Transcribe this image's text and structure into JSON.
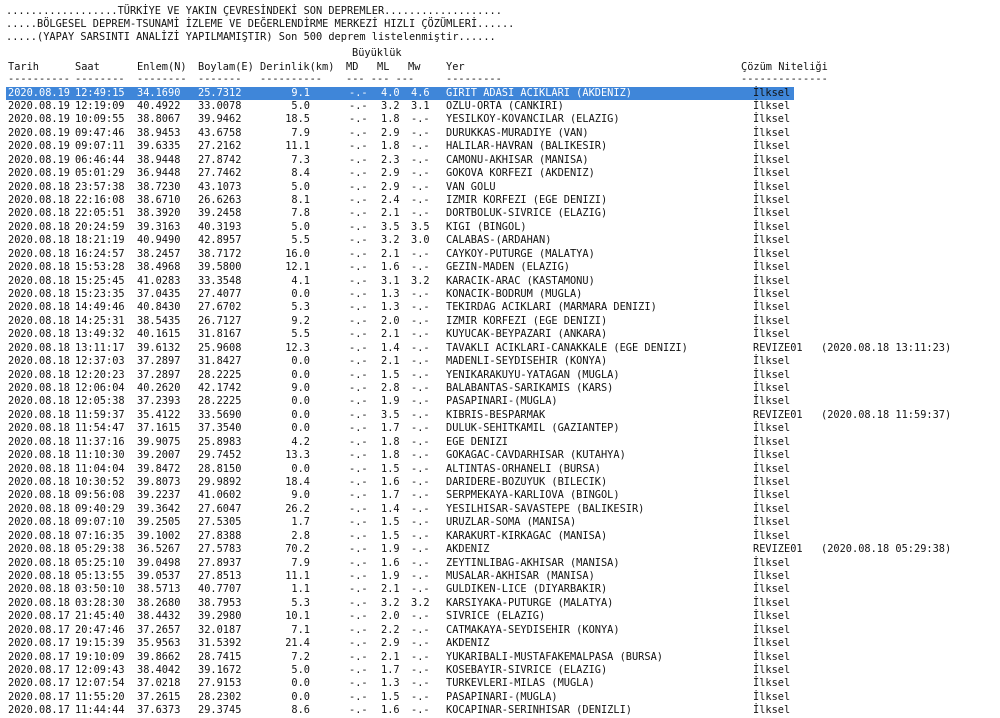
{
  "header": {
    "line1": "..................TÜRKİYE VE YAKIN ÇEVRESİNDEKİ SON DEPREMLER...................",
    "line2": ".....BÖLGESEL DEPREM-TSUNAMİ İZLEME VE DEĞERLENDİRME MERKEZİ HIZLI ÇÖZÜMLERİ......",
    "line3": ".....(YAPAY SARSINTI ANALİZİ YAPILMAMIŞTIR) Son 500 deprem listelenmiştir......"
  },
  "columns": {
    "buyukluk": "Büyüklük",
    "tarih": "Tarih",
    "saat": "Saat",
    "enlem": "Enlem(N)",
    "boylam": "Boylam(E)",
    "derinlik": "Derinlik(km)",
    "md": "MD",
    "ml": "ML",
    "mw": "Mw",
    "yer": "Yer",
    "cozum": "Çözüm Niteliği"
  },
  "dash_lines": {
    "tarih": "----------",
    "saat": "--------",
    "enlem": "--------",
    "boylam": "-------",
    "derinlik": "----------",
    "mag": "--- --- ---",
    "yer": "---------",
    "cozum": "--------------"
  },
  "rows": [
    {
      "date": "2020.08.19",
      "time": "12:49:15",
      "lat": "34.1690",
      "lon": "25.7312",
      "depth": "9.1",
      "md": "-.-",
      "ml": "4.0",
      "mw": "4.6",
      "place": "GIRIT ADASI ACIKLARI (AKDENIZ)",
      "quality": "İlksel",
      "selected": true
    },
    {
      "date": "2020.08.19",
      "time": "12:19:09",
      "lat": "40.4922",
      "lon": "33.0078",
      "depth": "5.0",
      "md": "-.-",
      "ml": "3.2",
      "mw": "3.1",
      "place": "OZLU-ORTA (CANKIRI)",
      "quality": "İlksel"
    },
    {
      "date": "2020.08.19",
      "time": "10:09:55",
      "lat": "38.8067",
      "lon": "39.9462",
      "depth": "18.5",
      "md": "-.-",
      "ml": "1.8",
      "mw": "-.-",
      "place": "YESILKOY-KOVANCILAR (ELAZIG)",
      "quality": "İlksel"
    },
    {
      "date": "2020.08.19",
      "time": "09:47:46",
      "lat": "38.9453",
      "lon": "43.6758",
      "depth": "7.9",
      "md": "-.-",
      "ml": "2.9",
      "mw": "-.-",
      "place": "DURUKKAS-MURADIYE (VAN)",
      "quality": "İlksel"
    },
    {
      "date": "2020.08.19",
      "time": "09:07:11",
      "lat": "39.6335",
      "lon": "27.2162",
      "depth": "11.1",
      "md": "-.-",
      "ml": "1.8",
      "mw": "-.-",
      "place": "HALILAR-HAVRAN (BALIKESIR)",
      "quality": "İlksel"
    },
    {
      "date": "2020.08.19",
      "time": "06:46:44",
      "lat": "38.9448",
      "lon": "27.8742",
      "depth": "7.3",
      "md": "-.-",
      "ml": "2.3",
      "mw": "-.-",
      "place": "CAMONU-AKHISAR (MANISA)",
      "quality": "İlksel"
    },
    {
      "date": "2020.08.19",
      "time": "05:01:29",
      "lat": "36.9448",
      "lon": "27.7462",
      "depth": "8.4",
      "md": "-.-",
      "ml": "2.9",
      "mw": "-.-",
      "place": "GOKOVA KORFEZI (AKDENIZ)",
      "quality": "İlksel"
    },
    {
      "date": "2020.08.18",
      "time": "23:57:38",
      "lat": "38.7230",
      "lon": "43.1073",
      "depth": "5.0",
      "md": "-.-",
      "ml": "2.9",
      "mw": "-.-",
      "place": "VAN GOLU",
      "quality": "İlksel"
    },
    {
      "date": "2020.08.18",
      "time": "22:16:08",
      "lat": "38.6710",
      "lon": "26.6263",
      "depth": "8.1",
      "md": "-.-",
      "ml": "2.4",
      "mw": "-.-",
      "place": "IZMIR KORFEZI (EGE DENIZI)",
      "quality": "İlksel"
    },
    {
      "date": "2020.08.18",
      "time": "22:05:51",
      "lat": "38.3920",
      "lon": "39.2458",
      "depth": "7.8",
      "md": "-.-",
      "ml": "2.1",
      "mw": "-.-",
      "place": "DORTBOLUK-SIVRICE (ELAZIG)",
      "quality": "İlksel"
    },
    {
      "date": "2020.08.18",
      "time": "20:24:59",
      "lat": "39.3163",
      "lon": "40.3193",
      "depth": "5.0",
      "md": "-.-",
      "ml": "3.5",
      "mw": "3.5",
      "place": "KIGI (BINGOL)",
      "quality": "İlksel"
    },
    {
      "date": "2020.08.18",
      "time": "18:21:19",
      "lat": "40.9490",
      "lon": "42.8957",
      "depth": "5.5",
      "md": "-.-",
      "ml": "3.2",
      "mw": "3.0",
      "place": "CALABAS-(ARDAHAN)",
      "quality": "İlksel"
    },
    {
      "date": "2020.08.18",
      "time": "16:24:57",
      "lat": "38.2457",
      "lon": "38.7172",
      "depth": "16.0",
      "md": "-.-",
      "ml": "2.1",
      "mw": "-.-",
      "place": "CAYKOY-PUTURGE (MALATYA)",
      "quality": "İlksel"
    },
    {
      "date": "2020.08.18",
      "time": "15:53:28",
      "lat": "38.4968",
      "lon": "39.5800",
      "depth": "12.1",
      "md": "-.-",
      "ml": "1.6",
      "mw": "-.-",
      "place": "GEZIN-MADEN (ELAZIG)",
      "quality": "İlksel"
    },
    {
      "date": "2020.08.18",
      "time": "15:25:45",
      "lat": "41.0283",
      "lon": "33.3548",
      "depth": "4.1",
      "md": "-.-",
      "ml": "3.1",
      "mw": "3.2",
      "place": "KARACIK-ARAC (KASTAMONU)",
      "quality": "İlksel"
    },
    {
      "date": "2020.08.18",
      "time": "15:23:35",
      "lat": "37.0435",
      "lon": "27.4077",
      "depth": "0.0",
      "md": "-.-",
      "ml": "1.3",
      "mw": "-.-",
      "place": "KONACIK-BODRUM (MUGLA)",
      "quality": "İlksel"
    },
    {
      "date": "2020.08.18",
      "time": "14:49:46",
      "lat": "40.8430",
      "lon": "27.6702",
      "depth": "5.3",
      "md": "-.-",
      "ml": "1.3",
      "mw": "-.-",
      "place": "TEKIRDAG ACIKLARI (MARMARA DENIZI)",
      "quality": "İlksel"
    },
    {
      "date": "2020.08.18",
      "time": "14:25:31",
      "lat": "38.5435",
      "lon": "26.7127",
      "depth": "9.2",
      "md": "-.-",
      "ml": "2.0",
      "mw": "-.-",
      "place": "IZMIR KORFEZI (EGE DENIZI)",
      "quality": "İlksel"
    },
    {
      "date": "2020.08.18",
      "time": "13:49:32",
      "lat": "40.1615",
      "lon": "31.8167",
      "depth": "5.5",
      "md": "-.-",
      "ml": "2.1",
      "mw": "-.-",
      "place": "KUYUCAK-BEYPAZARI (ANKARA)",
      "quality": "İlksel"
    },
    {
      "date": "2020.08.18",
      "time": "13:11:17",
      "lat": "39.6132",
      "lon": "25.9608",
      "depth": "12.3",
      "md": "-.-",
      "ml": "1.4",
      "mw": "-.-",
      "place": "TAVAKLI ACIKLARI-CANAKKALE (EGE DENIZI)",
      "quality": "REVIZE01",
      "revised": "(2020.08.18 13:11:23)"
    },
    {
      "date": "2020.08.18",
      "time": "12:37:03",
      "lat": "37.2897",
      "lon": "31.8427",
      "depth": "0.0",
      "md": "-.-",
      "ml": "2.1",
      "mw": "-.-",
      "place": "MADENLI-SEYDISEHIR (KONYA)",
      "quality": "İlksel"
    },
    {
      "date": "2020.08.18",
      "time": "12:20:23",
      "lat": "37.2897",
      "lon": "28.2225",
      "depth": "0.0",
      "md": "-.-",
      "ml": "1.5",
      "mw": "-.-",
      "place": "YENIKARAKUYU-YATAGAN (MUGLA)",
      "quality": "İlksel"
    },
    {
      "date": "2020.08.18",
      "time": "12:06:04",
      "lat": "40.2620",
      "lon": "42.1742",
      "depth": "9.0",
      "md": "-.-",
      "ml": "2.8",
      "mw": "-.-",
      "place": "BALABANTAS-SARIKAMIS (KARS)",
      "quality": "İlksel"
    },
    {
      "date": "2020.08.18",
      "time": "12:05:38",
      "lat": "37.2393",
      "lon": "28.2225",
      "depth": "0.0",
      "md": "-.-",
      "ml": "1.9",
      "mw": "-.-",
      "place": "PASAPINARI-(MUGLA)",
      "quality": "İlksel"
    },
    {
      "date": "2020.08.18",
      "time": "11:59:37",
      "lat": "35.4122",
      "lon": "33.5690",
      "depth": "0.0",
      "md": "-.-",
      "ml": "3.5",
      "mw": "-.-",
      "place": "KIBRIS-BESPARMAK",
      "quality": "REVIZE01",
      "revised": "(2020.08.18 11:59:37)"
    },
    {
      "date": "2020.08.18",
      "time": "11:54:47",
      "lat": "37.1615",
      "lon": "37.3540",
      "depth": "0.0",
      "md": "-.-",
      "ml": "1.7",
      "mw": "-.-",
      "place": "DULUK-SEHITKAMIL (GAZIANTEP)",
      "quality": "İlksel"
    },
    {
      "date": "2020.08.18",
      "time": "11:37:16",
      "lat": "39.9075",
      "lon": "25.8983",
      "depth": "4.2",
      "md": "-.-",
      "ml": "1.8",
      "mw": "-.-",
      "place": "EGE DENIZI",
      "quality": "İlksel"
    },
    {
      "date": "2020.08.18",
      "time": "11:10:30",
      "lat": "39.2007",
      "lon": "29.7452",
      "depth": "13.3",
      "md": "-.-",
      "ml": "1.8",
      "mw": "-.-",
      "place": "GOKAGAC-CAVDARHISAR (KUTAHYA)",
      "quality": "İlksel"
    },
    {
      "date": "2020.08.18",
      "time": "11:04:04",
      "lat": "39.8472",
      "lon": "28.8150",
      "depth": "0.0",
      "md": "-.-",
      "ml": "1.5",
      "mw": "-.-",
      "place": "ALTINTAS-ORHANELI (BURSA)",
      "quality": "İlksel"
    },
    {
      "date": "2020.08.18",
      "time": "10:30:52",
      "lat": "39.8073",
      "lon": "29.9892",
      "depth": "18.4",
      "md": "-.-",
      "ml": "1.6",
      "mw": "-.-",
      "place": "DARIDERE-BOZUYUK (BILECIK)",
      "quality": "İlksel"
    },
    {
      "date": "2020.08.18",
      "time": "09:56:08",
      "lat": "39.2237",
      "lon": "41.0602",
      "depth": "9.0",
      "md": "-.-",
      "ml": "1.7",
      "mw": "-.-",
      "place": "SERPMEKAYA-KARLIOVA (BINGOL)",
      "quality": "İlksel"
    },
    {
      "date": "2020.08.18",
      "time": "09:40:29",
      "lat": "39.3642",
      "lon": "27.6047",
      "depth": "26.2",
      "md": "-.-",
      "ml": "1.4",
      "mw": "-.-",
      "place": "YESILHISAR-SAVASTEPE (BALIKESIR)",
      "quality": "İlksel"
    },
    {
      "date": "2020.08.18",
      "time": "09:07:10",
      "lat": "39.2505",
      "lon": "27.5305",
      "depth": "1.7",
      "md": "-.-",
      "ml": "1.5",
      "mw": "-.-",
      "place": "URUZLAR-SOMA (MANISA)",
      "quality": "İlksel"
    },
    {
      "date": "2020.08.18",
      "time": "07:16:35",
      "lat": "39.1002",
      "lon": "27.8388",
      "depth": "2.8",
      "md": "-.-",
      "ml": "1.5",
      "mw": "-.-",
      "place": "KARAKURT-KIRKAGAC (MANISA)",
      "quality": "İlksel"
    },
    {
      "date": "2020.08.18",
      "time": "05:29:38",
      "lat": "36.5267",
      "lon": "27.5783",
      "depth": "70.2",
      "md": "-.-",
      "ml": "1.9",
      "mw": "-.-",
      "place": "AKDENIZ",
      "quality": "REVIZE01",
      "revised": "(2020.08.18 05:29:38)"
    },
    {
      "date": "2020.08.18",
      "time": "05:25:10",
      "lat": "39.0498",
      "lon": "27.8937",
      "depth": "7.9",
      "md": "-.-",
      "ml": "1.6",
      "mw": "-.-",
      "place": "ZEYTINLIBAG-AKHISAR (MANISA)",
      "quality": "İlksel"
    },
    {
      "date": "2020.08.18",
      "time": "05:13:55",
      "lat": "39.0537",
      "lon": "27.8513",
      "depth": "11.1",
      "md": "-.-",
      "ml": "1.9",
      "mw": "-.-",
      "place": "MUSALAR-AKHISAR (MANISA)",
      "quality": "İlksel"
    },
    {
      "date": "2020.08.18",
      "time": "03:50:10",
      "lat": "38.5713",
      "lon": "40.7707",
      "depth": "1.1",
      "md": "-.-",
      "ml": "2.1",
      "mw": "-.-",
      "place": "GULDIKEN-LICE (DIYARBAKIR)",
      "quality": "İlksel"
    },
    {
      "date": "2020.08.18",
      "time": "03:28:30",
      "lat": "38.2680",
      "lon": "38.7953",
      "depth": "5.3",
      "md": "-.-",
      "ml": "3.2",
      "mw": "3.2",
      "place": "KARSIYAKA-PUTURGE (MALATYA)",
      "quality": "İlksel"
    },
    {
      "date": "2020.08.17",
      "time": "21:45:40",
      "lat": "38.4432",
      "lon": "39.2980",
      "depth": "10.1",
      "md": "-.-",
      "ml": "2.0",
      "mw": "-.-",
      "place": "SIVRICE (ELAZIG)",
      "quality": "İlksel"
    },
    {
      "date": "2020.08.17",
      "time": "20:47:46",
      "lat": "37.2657",
      "lon": "32.0187",
      "depth": "7.1",
      "md": "-.-",
      "ml": "2.2",
      "mw": "-.-",
      "place": "CATMAKAYA-SEYDISEHIR (KONYA)",
      "quality": "İlksel"
    },
    {
      "date": "2020.08.17",
      "time": "19:15:39",
      "lat": "35.9563",
      "lon": "31.5392",
      "depth": "21.4",
      "md": "-.-",
      "ml": "2.9",
      "mw": "-.-",
      "place": "AKDENIZ",
      "quality": "İlksel"
    },
    {
      "date": "2020.08.17",
      "time": "19:10:09",
      "lat": "39.8662",
      "lon": "28.7415",
      "depth": "7.2",
      "md": "-.-",
      "ml": "2.1",
      "mw": "-.-",
      "place": "YUKARIBALI-MUSTAFAKEMALPASA (BURSA)",
      "quality": "İlksel"
    },
    {
      "date": "2020.08.17",
      "time": "12:09:43",
      "lat": "38.4042",
      "lon": "39.1672",
      "depth": "5.0",
      "md": "-.-",
      "ml": "1.7",
      "mw": "-.-",
      "place": "KOSEBAYIR-SIVRICE (ELAZIG)",
      "quality": "İlksel"
    },
    {
      "date": "2020.08.17",
      "time": "12:07:54",
      "lat": "37.0218",
      "lon": "27.9153",
      "depth": "0.0",
      "md": "-.-",
      "ml": "1.3",
      "mw": "-.-",
      "place": "TURKEVLERI-MILAS (MUGLA)",
      "quality": "İlksel"
    },
    {
      "date": "2020.08.17",
      "time": "11:55:20",
      "lat": "37.2615",
      "lon": "28.2302",
      "depth": "0.0",
      "md": "-.-",
      "ml": "1.5",
      "mw": "-.-",
      "place": "PASAPINARI-(MUGLA)",
      "quality": "İlksel"
    },
    {
      "date": "2020.08.17",
      "time": "11:44:44",
      "lat": "37.6373",
      "lon": "29.3745",
      "depth": "8.6",
      "md": "-.-",
      "ml": "1.6",
      "mw": "-.-",
      "place": "KOCAPINAR-SERINHISAR (DENIZLI)",
      "quality": "İlksel"
    }
  ]
}
